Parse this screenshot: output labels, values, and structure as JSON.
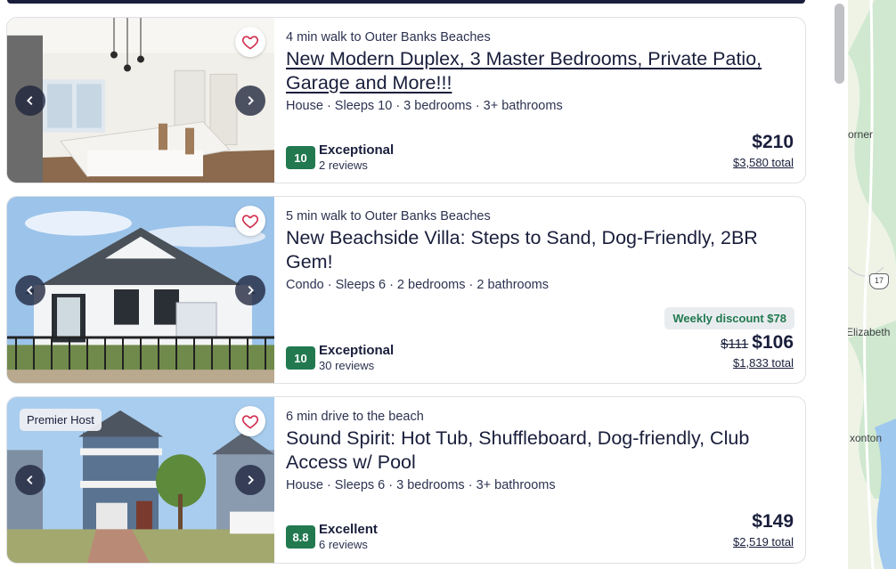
{
  "listings": [
    {
      "subtitle": "4 min walk to Outer Banks Beaches",
      "title": "New Modern Duplex, 3 Master Bedrooms, Private Patio, Garage and More!!!",
      "meta": "House · Sleeps 10 · 3 bedrooms · 3+ bathrooms",
      "score": "10",
      "rating_label": "Exceptional",
      "reviews": "2 reviews",
      "price": "$210",
      "total": "$3,580 total"
    },
    {
      "subtitle": "5 min walk to Outer Banks Beaches",
      "title": "New Beachside Villa: Steps to Sand, Dog-Friendly, 2BR Gem!",
      "meta": "Condo · Sleeps 6 · 2 bedrooms · 2 bathrooms",
      "score": "10",
      "rating_label": "Exceptional",
      "reviews": "30 reviews",
      "discount": "Weekly discount $78",
      "old_price": "$111",
      "price": "$106",
      "total": "$1,833 total"
    },
    {
      "host_badge": "Premier Host",
      "subtitle": "6 min drive to the beach",
      "title": "Sound Spirit: Hot Tub, Shuffleboard, Dog-friendly, Club Access w/ Pool",
      "meta": "House · Sleeps 6 · 3 bedrooms · 3+ bathrooms",
      "score": "8.8",
      "rating_label": "Excellent",
      "reviews": "6 reviews",
      "price": "$149",
      "total": "$2,519 total"
    }
  ],
  "map": {
    "labels": [
      "orner",
      "Elizabeth",
      "xonton"
    ],
    "route_shield": "17"
  },
  "icons": {
    "favorite": "heart-icon",
    "prev": "chevron-left-icon",
    "next": "chevron-right-icon",
    "gallery": "gallery-icon"
  },
  "colors": {
    "rating_badge": "#227950",
    "text": "#191e3b",
    "discount_text": "#227950",
    "heart": "#d32f4f"
  }
}
